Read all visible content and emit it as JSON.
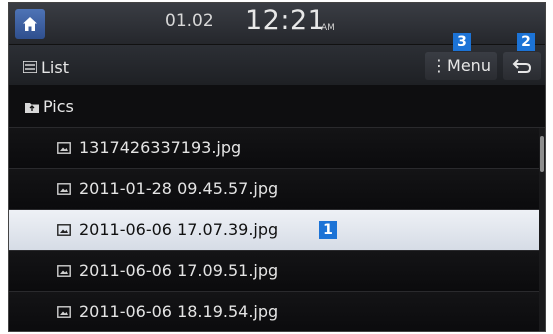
{
  "status": {
    "date": "01.02",
    "time": "12:21",
    "ampm": "AM"
  },
  "toolbar": {
    "list_label": "List",
    "menu_label": "Menu",
    "callout_menu": "3",
    "callout_back": "2"
  },
  "folder": {
    "name": "Pics"
  },
  "files": [
    {
      "name": "1317426337193.jpg",
      "selected": false
    },
    {
      "name": "2011-01-28 09.45.57.jpg",
      "selected": false
    },
    {
      "name": "2011-06-06 17.07.39.jpg",
      "selected": true,
      "callout": "1"
    },
    {
      "name": "2011-06-06 17.09.51.jpg",
      "selected": false
    },
    {
      "name": "2011-06-06 18.19.54.jpg",
      "selected": false
    }
  ],
  "colors": {
    "accent": "#1c73d6",
    "selected_row": "#e2e7ef",
    "background": "#0e0e10"
  },
  "icons": {
    "home": "home-icon",
    "list": "list-icon",
    "back": "back-arrow-icon",
    "folder": "folder-icon",
    "file": "image-file-icon"
  }
}
